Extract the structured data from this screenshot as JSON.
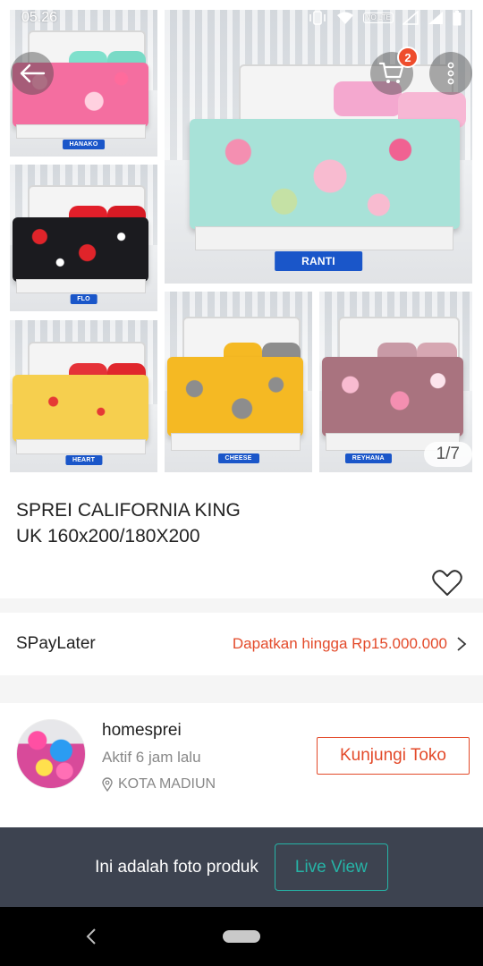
{
  "status_bar": {
    "time": "05.26",
    "network_label": "VO LTE"
  },
  "gallery": {
    "tiles": [
      {
        "label": "HANAKO"
      },
      {
        "label": "RANTI"
      },
      {
        "label": "FLO"
      },
      {
        "label": "HEART"
      },
      {
        "label": "CHEESE"
      },
      {
        "label": "REYHANA"
      }
    ],
    "counter": "1/7",
    "cart_count": "2"
  },
  "product": {
    "title_line1": "SPREI CALIFORNIA KING",
    "title_line2": "UK 160x200/180X200"
  },
  "spaylater": {
    "label": "SPayLater",
    "value": "Dapatkan hingga Rp15.000.000"
  },
  "shop": {
    "name": "homesprei",
    "active": "Aktif 6 jam lalu",
    "location": "KOTA MADIUN",
    "visit_label": "Kunjungi Toko"
  },
  "banner": {
    "text": "Ini adalah foto produk",
    "button": "Live View"
  },
  "colors": {
    "accent": "#e34a2a",
    "teal": "#26b3a6",
    "banner_bg": "#3d4350"
  }
}
